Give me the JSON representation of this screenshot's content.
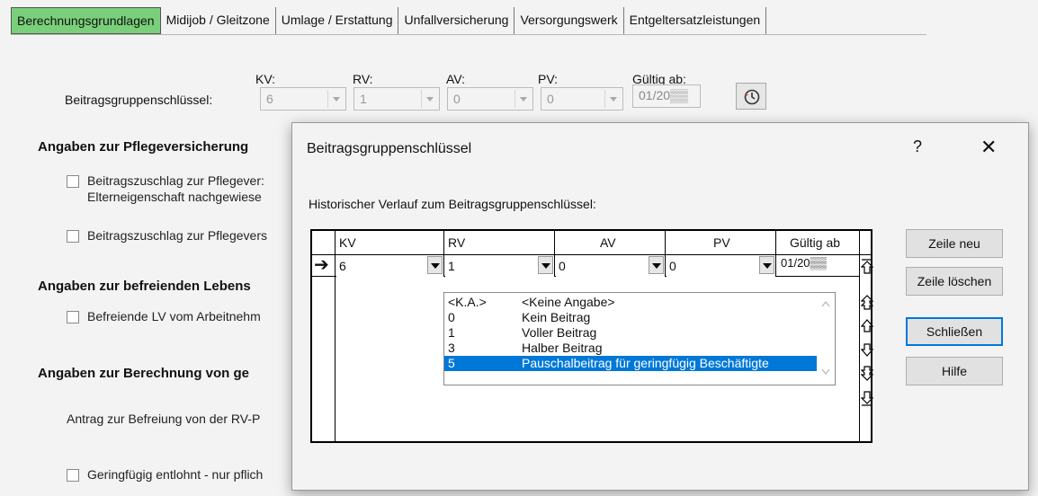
{
  "tabs": [
    {
      "label": "Berechnungsgrundlagen",
      "active": true
    },
    {
      "label": "Midijob / Gleitzone",
      "active": false
    },
    {
      "label": "Umlage / Erstattung",
      "active": false
    },
    {
      "label": "Unfallversicherung",
      "active": false
    },
    {
      "label": "Versorgungswerk",
      "active": false
    },
    {
      "label": "Entgeltersatzleistungen",
      "active": false
    }
  ],
  "background": {
    "group_label": "Beitragsgruppenschlüssel:",
    "headers": {
      "kv": "KV:",
      "rv": "RV:",
      "av": "AV:",
      "pv": "PV:",
      "valid": "Gültig ab:"
    },
    "values": {
      "kv": "6",
      "rv": "1",
      "av": "0",
      "pv": "0",
      "valid": "01/20▒▒"
    },
    "sections": {
      "pflege": "Angaben zur Pflegeversicherung",
      "lebens": "Angaben zur befreienden Lebens",
      "berechnung": "Angaben zur Berechnung von ge"
    },
    "checkboxes": {
      "pflege1_line1": "Beitragszuschlag zur Pflegever:",
      "pflege1_line2": "Elterneigenschaft nachgewiese",
      "pflege2": "Beitragszuschlag zur Pflegevers",
      "lv": "Befreiende LV vom Arbeitnehm",
      "gering": "Geringfügig entlohnt - nur pflich"
    },
    "antrag": "Antrag zur Befreiung von der RV-P"
  },
  "dialog": {
    "title": "Beitragsgruppenschlüssel",
    "help_glyph": "?",
    "close_glyph": "✕",
    "caption": "Historischer Verlauf zum Beitragsgruppenschlüssel:",
    "columns": {
      "kv": "KV",
      "rv": "RV",
      "av": "AV",
      "pv": "PV",
      "valid": "Gültig ab"
    },
    "row": {
      "indicator": "➔",
      "kv": "6",
      "rv": "1",
      "av": "0",
      "pv": "0",
      "valid": "01/20▒▒"
    },
    "dropdown": [
      {
        "code": "<K.A.>",
        "text": "<Keine Angabe>"
      },
      {
        "code": "0",
        "text": "Kein Beitrag"
      },
      {
        "code": "1",
        "text": "Voller Beitrag"
      },
      {
        "code": "3",
        "text": "Halber Beitrag"
      },
      {
        "code": "5",
        "text": "Pauschalbeitrag für geringfügig Beschäftigte",
        "selected": true
      }
    ],
    "buttons": {
      "new_row": "Zeile neu",
      "delete_row": "Zeile löschen",
      "close": "Schließen",
      "help": "Hilfe"
    }
  },
  "colors": {
    "active_tab": "#7ad07a",
    "selection": "#0078d7"
  }
}
